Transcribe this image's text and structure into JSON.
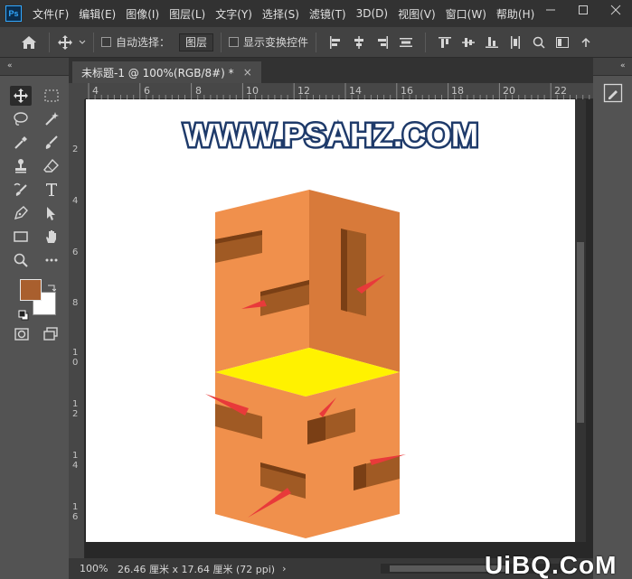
{
  "app": {
    "logo": "Ps"
  },
  "menu": [
    "文件(F)",
    "编辑(E)",
    "图像(I)",
    "图层(L)",
    "文字(Y)",
    "选择(S)",
    "滤镜(T)",
    "3D(D)",
    "视图(V)",
    "窗口(W)",
    "帮助(H)"
  ],
  "window_controls": [
    "minimize-icon",
    "maximize-icon",
    "close-icon"
  ],
  "options": {
    "auto_select_label": "自动选择：",
    "auto_select_value": "图层",
    "show_transform_label": "显示变换控件",
    "collapse_glyph": "«"
  },
  "document": {
    "tab_title": "未标题-1 @ 100%(RGB/8#) *",
    "tab_close": "×",
    "ruler_h": [
      "4",
      "6",
      "8",
      "10",
      "12",
      "14",
      "16",
      "18",
      "20",
      "22"
    ],
    "ruler_v": [
      "2",
      "4",
      "6",
      "8",
      "10",
      "12",
      "14",
      "16"
    ],
    "canvas_text": "WWW.PSAHZ.COM",
    "status_zoom": "100%",
    "status_doc": "26.46 厘米 x 17.64 厘米 (72 ppi)",
    "status_arrow": "›"
  },
  "colors": {
    "foreground": "#a95f2e",
    "background": "#ffffff",
    "face_light": "#f0904c",
    "face_side": "#d87a3a",
    "top_yellow": "#fff200",
    "arrow_red": "#e83a3a",
    "logo_blue": "#1e3a6a"
  },
  "tools": [
    "move-tool-icon",
    "marquee-tool-icon",
    "lasso-tool-icon",
    "magic-wand-icon",
    "eyedropper-icon",
    "brush-tool-icon",
    "stamp-tool-icon",
    "eraser-tool-icon",
    "history-brush-icon",
    "type-tool-icon",
    "pen-tool-icon",
    "path-select-icon",
    "rectangle-tool-icon",
    "hand-tool-icon",
    "zoom-tool-icon",
    "more-tools-icon",
    "quick-mask-icon",
    "screen-mode-icon"
  ],
  "watermark": "UiBQ.CoM"
}
